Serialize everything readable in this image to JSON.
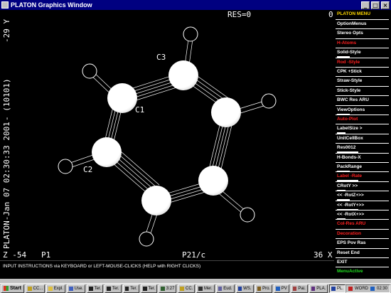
{
  "window": {
    "title": "PLATON Graphics Window",
    "buttons": {
      "minimize": "_",
      "maximize": "□",
      "close": "×"
    }
  },
  "canvas": {
    "top_left_text": "RES=0",
    "top_right_text": "0",
    "left_vertical_top": "-29 Y",
    "left_vertical_mid": "- (10101)",
    "left_vertical_bottom": "PLATON-Jan 07 02:30:33 2001",
    "bottom_left_z": "Z -54",
    "bottom_p1": "P1",
    "bottom_space_group": "P21/c",
    "bottom_right_x": "36 X",
    "atom_labels": {
      "c1": "C1",
      "c2": "C2",
      "c3": "C3"
    }
  },
  "menu": {
    "header": "PLATON MENU",
    "items": [
      {
        "label": "OptionMenus",
        "color": "white"
      },
      {
        "label": "Stereo Opts",
        "color": "white"
      },
      {
        "label": "H-Atoms",
        "color": "red"
      },
      {
        "label": "Solid-Style",
        "color": "white"
      },
      {
        "label": "Rod -Style",
        "color": "red"
      },
      {
        "label": "CPK +Stick",
        "color": "white"
      },
      {
        "label": "Straw-Style",
        "color": "white"
      },
      {
        "label": "Stick-Style",
        "color": "white"
      },
      {
        "label": "BWC Res ARU",
        "color": "white"
      },
      {
        "label": "ViewOptions",
        "color": "white"
      },
      {
        "label": "Auto-Plot",
        "color": "red"
      },
      {
        "label": "LabelSize >",
        "color": "white"
      },
      {
        "label": "UnitCellBox",
        "color": "white"
      },
      {
        "label": "Res0012",
        "color": "white"
      },
      {
        "label": "H-Bonds-X",
        "color": "white"
      },
      {
        "label": "PackRange",
        "color": "white"
      },
      {
        "label": "Label -Rate",
        "color": "red"
      },
      {
        "label": "CRotY >>",
        "color": "white"
      },
      {
        "label": "<< -RotZ+>>",
        "color": "white"
      },
      {
        "label": "<< -RotY+>>",
        "color": "white"
      },
      {
        "label": "<< -RotX+>>",
        "color": "white"
      },
      {
        "label": "Col-Res ARU",
        "color": "red"
      },
      {
        "label": "Decoration",
        "color": "red"
      },
      {
        "label": "EPS Pov Ras",
        "color": "white"
      },
      {
        "label": "Reset   End",
        "color": "white"
      },
      {
        "label": "EXIT",
        "color": "white"
      },
      {
        "label": "MenuActive",
        "color": "green"
      }
    ]
  },
  "instructions": "INPUT INSTRUCTIONS via KEYBOARD or LEFT-MOUSE-CLICKS (HELP with RIGHT CLICKS)",
  "taskbar": {
    "start": "Start",
    "buttons": [
      "CC...",
      "Expl.",
      "Use.",
      "Ter.",
      "Ter.",
      "Ter.",
      "Ter.",
      "3:27",
      "CC.",
      "Mer.",
      "Eud.",
      "WS.",
      "Pro.",
      "PV",
      "Pai.",
      "PLA.",
      "PL."
    ],
    "active_index": 16,
    "clock": "02:30",
    "tray_label": "WORD"
  },
  "colors": {
    "titlebar": "#000080",
    "canvas_bg": "#000000",
    "menu_header": "#ffd700",
    "red_item": "#ff2020",
    "green_item": "#20e020"
  }
}
